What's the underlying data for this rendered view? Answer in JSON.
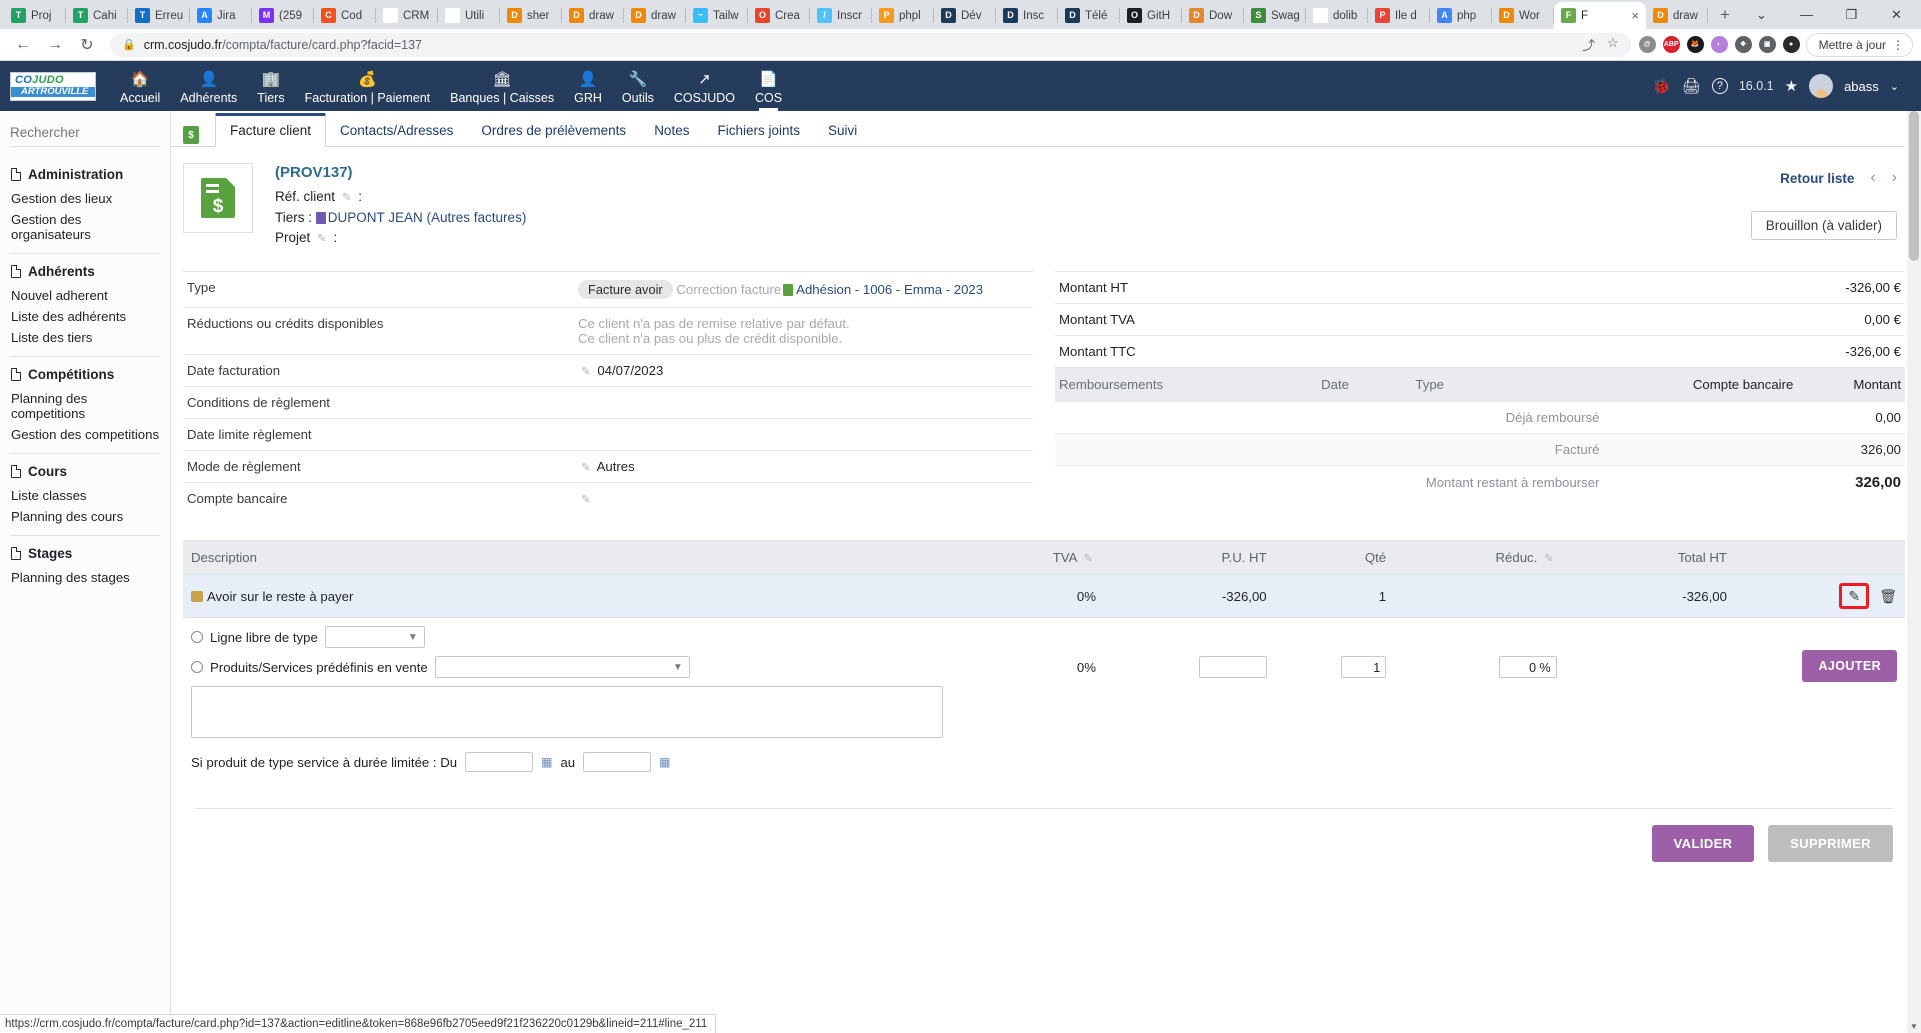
{
  "browser": {
    "tabs": [
      {
        "label": "Proj",
        "color": "#21a366",
        "glyph": "T"
      },
      {
        "label": "Cahi",
        "color": "#21a366",
        "glyph": "T"
      },
      {
        "label": "Erreu",
        "color": "#0f6fc6",
        "glyph": "T"
      },
      {
        "label": "Jira",
        "color": "#2684ff",
        "glyph": "A"
      },
      {
        "label": "(259",
        "color": "#7b2ff7",
        "glyph": "M"
      },
      {
        "label": "Cod",
        "color": "#f4511e",
        "glyph": "C"
      },
      {
        "label": "CRM",
        "color": "#ffffff",
        "glyph": "K"
      },
      {
        "label": "Utili",
        "color": "#ffffff",
        "glyph": "G"
      },
      {
        "label": "sher",
        "color": "#f08705",
        "glyph": "D"
      },
      {
        "label": "draw",
        "color": "#f08705",
        "glyph": "D"
      },
      {
        "label": "draw",
        "color": "#f08705",
        "glyph": "D"
      },
      {
        "label": "Tailw",
        "color": "#38bdf8",
        "glyph": "~"
      },
      {
        "label": "Crea",
        "color": "#e8452c",
        "glyph": "O"
      },
      {
        "label": "Inscr",
        "color": "#4fc3f7",
        "glyph": "/"
      },
      {
        "label": "phpl",
        "color": "#f89a1c",
        "glyph": "P"
      },
      {
        "label": "Dév",
        "color": "#1b3a5c",
        "glyph": "D"
      },
      {
        "label": "Insc",
        "color": "#1b3a5c",
        "glyph": "D"
      },
      {
        "label": "Télé",
        "color": "#1b3a5c",
        "glyph": "D"
      },
      {
        "label": "GitH",
        "color": "#1b1f23",
        "glyph": "O"
      },
      {
        "label": "Dow",
        "color": "#e8862b",
        "glyph": "D"
      },
      {
        "label": "Swag",
        "color": "#3b8c3b",
        "glyph": "S"
      },
      {
        "label": "dolib",
        "color": "#ffffff",
        "glyph": "G"
      },
      {
        "label": "Ile d",
        "color": "#e94335",
        "glyph": "P"
      },
      {
        "label": "php",
        "color": "#4285f4",
        "glyph": "A"
      },
      {
        "label": "Wor",
        "color": "#f08705",
        "glyph": "D"
      }
    ],
    "active_tab": {
      "label": "F",
      "close": "×"
    },
    "tab_after_active": {
      "label": "draw",
      "color": "#f08705",
      "glyph": "D"
    },
    "new_tab": "+",
    "window_controls": {
      "chevron": "⌄",
      "minimize": "—",
      "maximize": "❐",
      "close": "✕"
    },
    "nav": {
      "back": "←",
      "forward": "→",
      "reload": "↻",
      "lock": "🔒"
    },
    "url_prefix": "crm.cosjudo.fr",
    "url_path": "/compta/facture/card.php?facid=137",
    "share_icon": "⤴",
    "star_icon": "☆",
    "update_button": "Mettre à jour",
    "kebab": "⋮",
    "extensions": [
      {
        "name": "pocket-icon",
        "color": "#8b8b8b",
        "glyph": "@"
      },
      {
        "name": "adblock-icon",
        "color": "#d9202c",
        "glyph": "ABP"
      },
      {
        "name": "metamask-icon",
        "color": "#1b1b1b",
        "glyph": "🦊"
      },
      {
        "name": "colorzilla-icon",
        "color": "#b57edc",
        "glyph": "◐"
      },
      {
        "name": "puzzle-icon",
        "color": "#5f6368",
        "glyph": "❖"
      },
      {
        "name": "sidepanel-icon",
        "color": "#5f6368",
        "glyph": "▣"
      },
      {
        "name": "profile-icon",
        "color": "#2b2b2b",
        "glyph": "●"
      }
    ]
  },
  "app": {
    "logo": {
      "line1_a": "CO",
      "line1_b": "JUDO",
      "line2": "ARTROUVILLE"
    },
    "menu": [
      {
        "label": "Accueil",
        "icon": "🏠",
        "active": false
      },
      {
        "label": "Adhérents",
        "icon": "👤",
        "active": false
      },
      {
        "label": "Tiers",
        "icon": "🏢",
        "active": false
      },
      {
        "label": "Facturation | Paiement",
        "icon": "💰",
        "active": false
      },
      {
        "label": "Banques | Caisses",
        "icon": "🏛",
        "active": false
      },
      {
        "label": "GRH",
        "icon": "👤",
        "active": false
      },
      {
        "label": "Outils",
        "icon": "🔧",
        "active": false
      },
      {
        "label": "COSJUDO",
        "icon": "↗",
        "active": false
      },
      {
        "label": "COS",
        "icon": "📄",
        "active": true
      }
    ],
    "header_right": {
      "bug_icon": "🐞",
      "print_icon": "🖨",
      "help_icon": "?",
      "version": "16.0.1",
      "star_icon": "★",
      "user": "abass",
      "caret": "⌄"
    }
  },
  "sidebar": {
    "search_placeholder": "Rechercher",
    "groups": [
      {
        "title": "Administration",
        "items": [
          "Gestion des lieux",
          "Gestion des organisateurs"
        ]
      },
      {
        "title": "Adhérents",
        "items": [
          "Nouvel adherent",
          "Liste des adhérents",
          "Liste des tiers"
        ]
      },
      {
        "title": "Compétitions",
        "items": [
          "Planning des competitions",
          "Gestion des competitions"
        ]
      },
      {
        "title": "Cours",
        "items": [
          "Liste classes",
          "Planning des cours"
        ]
      },
      {
        "title": "Stages",
        "items": [
          "Planning des stages"
        ]
      }
    ]
  },
  "doc_tabs": [
    {
      "label": "Facture client",
      "active": true
    },
    {
      "label": "Contacts/Adresses",
      "active": false
    },
    {
      "label": "Ordres de prélèvements",
      "active": false
    },
    {
      "label": "Notes",
      "active": false
    },
    {
      "label": "Fichiers joints",
      "active": false
    },
    {
      "label": "Suivi",
      "active": false
    }
  ],
  "object_head": {
    "ref": "(PROV137)",
    "ref_client_label": "Réf. client",
    "ref_client_value": "",
    "tiers_label": "Tiers :",
    "tiers_value": "DUPONT JEAN (Autres factures)",
    "projet_label": "Projet",
    "projet_value": "",
    "retour_liste": "Retour liste",
    "prev_arrow": "‹",
    "next_arrow": "›",
    "status": "Brouillon (à valider)"
  },
  "info_left": [
    {
      "label": "Type",
      "type": "type",
      "badge": "Facture avoir",
      "note": "Correction facture",
      "link": "Adhésion - 1006 - Emma - 2023"
    },
    {
      "label": "Réductions ou crédits disponibles",
      "type": "muted2",
      "line1": "Ce client n'a pas de remise relative par défaut.",
      "line2": "Ce client n'a pas ou plus de crédit disponible."
    },
    {
      "label": "Date facturation",
      "type": "edit",
      "value": "04/07/2023"
    },
    {
      "label": "Conditions de règlement",
      "type": "plain",
      "value": ""
    },
    {
      "label": "Date limite règlement",
      "type": "plain",
      "value": ""
    },
    {
      "label": "Mode de règlement",
      "type": "edit",
      "value": "Autres"
    },
    {
      "label": "Compte bancaire",
      "type": "edit",
      "value": ""
    }
  ],
  "amounts": [
    {
      "label": "Montant HT",
      "value": "-326,00 €"
    },
    {
      "label": "Montant TVA",
      "value": "0,00 €"
    },
    {
      "label": "Montant TTC",
      "value": "-326,00 €"
    }
  ],
  "remboursements": {
    "headers": [
      "Remboursements",
      "Date",
      "Type",
      "Compte bancaire",
      "Montant"
    ],
    "rows": [
      {
        "label": "Déjà remboursé",
        "value": "0,00",
        "style": "teal"
      },
      {
        "label": "Facturé",
        "value": "326,00",
        "style": "plain"
      },
      {
        "label": "Montant restant à rembourser",
        "value": "326,00",
        "style": "big"
      }
    ]
  },
  "lines": {
    "headers": {
      "description": "Description",
      "tva": "TVA",
      "pu_ht": "P.U. HT",
      "qte": "Qté",
      "reduc": "Réduc.",
      "total_ht": "Total HT"
    },
    "rows": [
      {
        "description": "Avoir sur le reste à payer",
        "tva": "0%",
        "pu_ht": "-326,00",
        "qte": "1",
        "reduc": "",
        "total_ht": "-326,00",
        "edit_icon": "✎",
        "delete_icon": "🗑"
      }
    ]
  },
  "add_line": {
    "radio1_label": "Ligne libre de type",
    "radio1_select_value": "",
    "radio2_label": "Produits/Services prédéfinis en vente",
    "radio2_select_value": "",
    "description_value": "",
    "tva": "0%",
    "pu_ht": "",
    "qte": "1",
    "reduc": "0 %",
    "add_button": "AJOUTER",
    "duration_label": "Si produit de type service à durée limitée : Du",
    "duration_from": "",
    "duration_mid": "au",
    "duration_to": ""
  },
  "footer": {
    "validate": "VALIDER",
    "delete": "SUPPRIMER"
  },
  "status_bar": "https://crm.cosjudo.fr/compta/facture/card.php?id=137&action=editline&token=868e96fb2705eed9f21f236220c0129b&lineid=211#line_211",
  "colors": {
    "app_header": "#263c5c",
    "accent_purple": "#9c5fa8",
    "highlight_red": "#ee1b24",
    "link_blue": "#2b4a7d"
  }
}
